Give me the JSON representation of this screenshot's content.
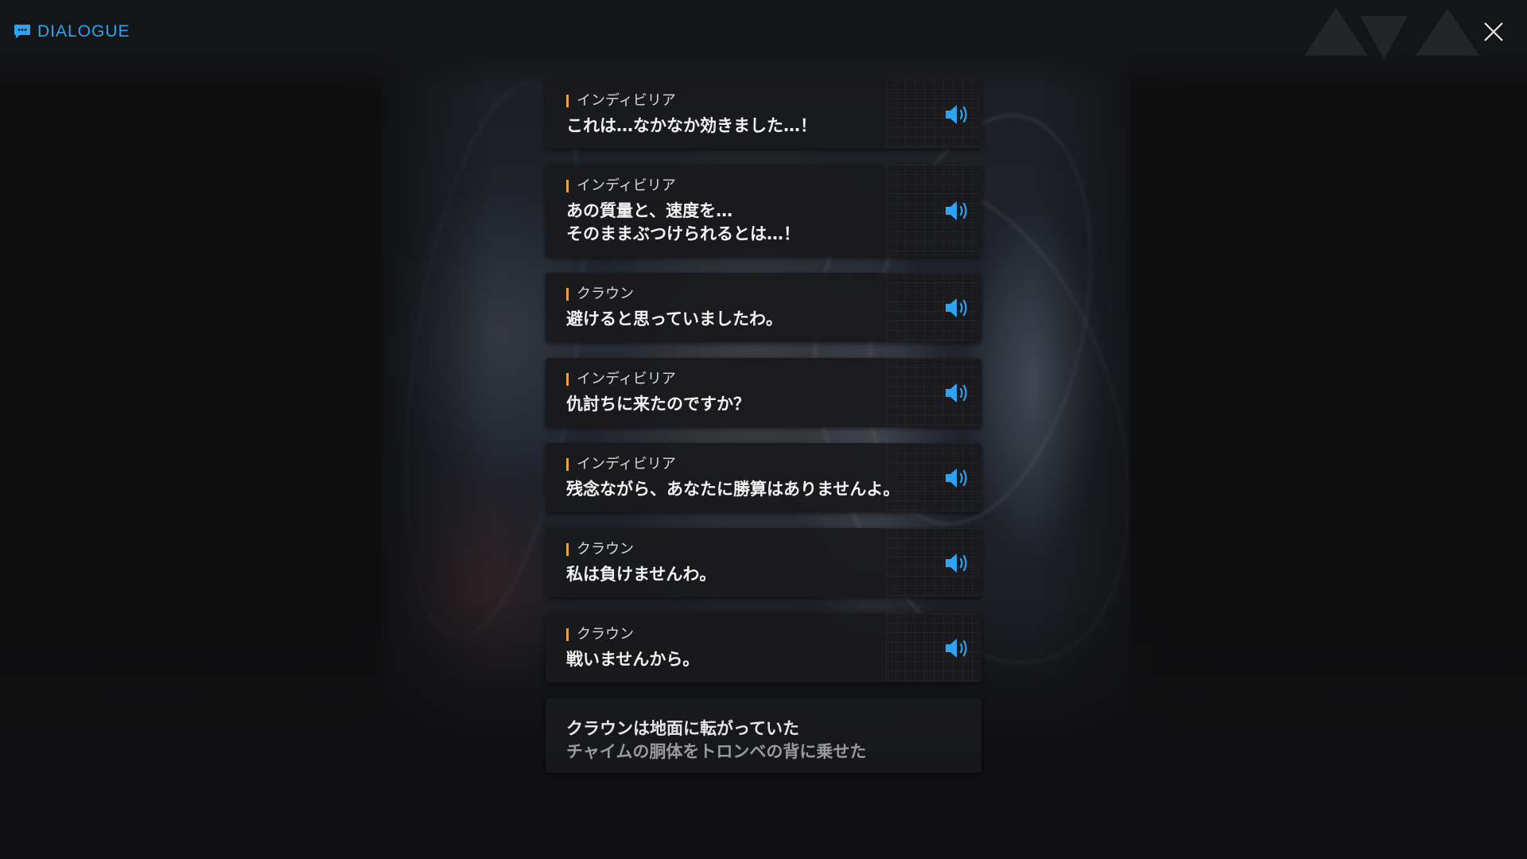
{
  "header": {
    "title": "DIALOGUE",
    "title_icon": "chat-bubble-icon",
    "accent_color": "#2ea3f2",
    "close_icon": "close-icon"
  },
  "entries": [
    {
      "speaker": "インディビリア",
      "text": "これは…なかなか効きました…！",
      "voice_icon": "speaker-icon"
    },
    {
      "speaker": "インディビリア",
      "text": "あの質量と、速度を…\nそのままぶつけられるとは…！",
      "voice_icon": "speaker-icon"
    },
    {
      "speaker": "クラウン",
      "text": "避けると思っていましたわ。",
      "voice_icon": "speaker-icon"
    },
    {
      "speaker": "インディビリア",
      "text": "仇討ちに来たのですか？",
      "voice_icon": "speaker-icon"
    },
    {
      "speaker": "インディビリア",
      "text": "残念ながら、あなたに勝算はありませんよ。",
      "voice_icon": "speaker-icon"
    },
    {
      "speaker": "クラウン",
      "text": "私は負けませんわ。",
      "voice_icon": "speaker-icon"
    },
    {
      "speaker": "クラウン",
      "text": "戦いませんから。",
      "voice_icon": "speaker-icon"
    }
  ],
  "narration": {
    "line1": "クラウンは地面に転がっていた",
    "line2": "チャイムの胴体をトロンベの背に乗せた"
  },
  "colors": {
    "speaker_marker": "#e8a23a",
    "voice_icon": "#2ea3f2",
    "panel": "#191a1d"
  }
}
